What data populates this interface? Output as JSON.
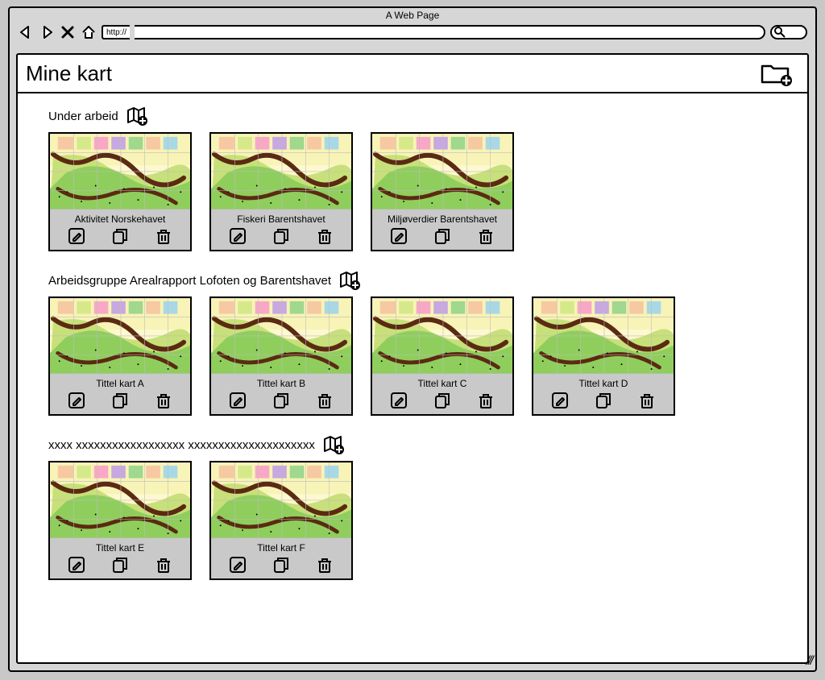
{
  "browser": {
    "window_title": "A Web Page",
    "url_label": "http://",
    "url_value": ""
  },
  "page": {
    "title": "Mine kart"
  },
  "sections": [
    {
      "title": "Under arbeid",
      "cards": [
        {
          "title": "Aktivitet Norskehavet"
        },
        {
          "title": "Fiskeri Barentshavet"
        },
        {
          "title": "Miljøverdier Barentshavet"
        }
      ]
    },
    {
      "title": "Arbeidsgruppe Arealrapport Lofoten og Barentshavet",
      "cards": [
        {
          "title": "Tittel kart A"
        },
        {
          "title": "Tittel kart B"
        },
        {
          "title": "Tittel kart C"
        },
        {
          "title": "Tittel kart D"
        }
      ]
    },
    {
      "title": "xxxx  xxxxxxxxxxxxxxxxxx xxxxxxxxxxxxxxxxxxxxx",
      "cards": [
        {
          "title": "Tittel kart E"
        },
        {
          "title": "Tittel kart F"
        }
      ]
    }
  ]
}
